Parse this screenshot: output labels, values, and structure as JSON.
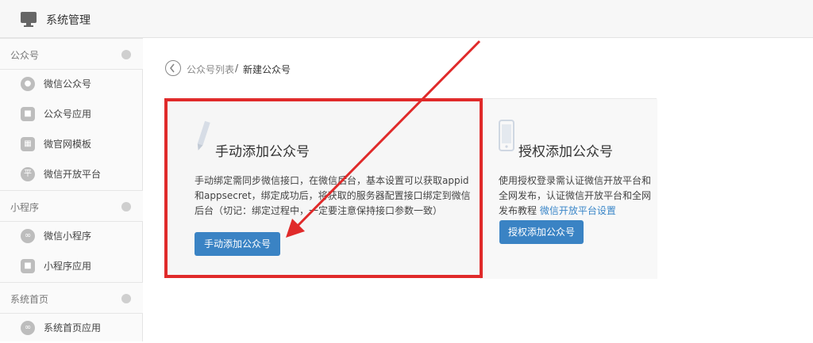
{
  "topbar": {
    "title": "系统管理",
    "icon": "monitor-icon"
  },
  "sidebar": {
    "groups": [
      {
        "label": "公众号",
        "items": [
          {
            "label": "微信公众号",
            "icon": "wechat-icon"
          },
          {
            "label": "公众号应用",
            "icon": "app-bag-icon"
          },
          {
            "label": "微官网模板",
            "icon": "template-icon"
          },
          {
            "label": "微信开放平台",
            "icon": "open-platform-icon",
            "glyph": "平"
          }
        ]
      },
      {
        "label": "小程序",
        "items": [
          {
            "label": "微信小程序",
            "icon": "mini-program-icon"
          },
          {
            "label": "小程序应用",
            "icon": "app-bag-icon"
          }
        ]
      },
      {
        "label": "系统首页",
        "items": [
          {
            "label": "系统首页应用",
            "icon": "mini-program-icon"
          }
        ]
      }
    ]
  },
  "breadcrumb": {
    "parent": "公众号列表",
    "separator": "/",
    "current": "新建公众号"
  },
  "manual_card": {
    "title": "手动添加公众号",
    "desc": "手动绑定需同步微信接口，在微信后台，基本设置可以获取appid和appsecret，绑定成功后，将获取的服务器配置接口绑定到微信后台（切记：绑定过程中，一定要注意保持接口参数一致）",
    "button": "手动添加公众号",
    "icon": "pencil-icon"
  },
  "auth_card": {
    "title": "授权添加公众号",
    "desc": "使用授权登录需认证微信开放平台和全网发布，认证微信开放平台和全网发布教程",
    "link": "微信开放平台设置",
    "button": "授权添加公众号",
    "icon": "phone-icon"
  },
  "colors": {
    "accent": "#3a83c4",
    "annotation": "#e02a2a",
    "link": "#3a86c8"
  }
}
